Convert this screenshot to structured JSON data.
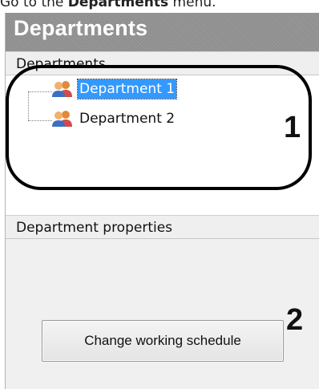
{
  "caption": {
    "prefix": "Go to the ",
    "bold": "Departments",
    "suffix": " menu."
  },
  "window": {
    "title": "Departments",
    "departments_header": "Departments",
    "properties_header": "Department properties"
  },
  "tree": {
    "items": [
      {
        "label": "Department 1",
        "selected": true,
        "icon": "group-users-icon"
      },
      {
        "label": "Department 2",
        "selected": false,
        "icon": "group-users-icon"
      }
    ]
  },
  "properties": {
    "change_schedule_label": "Change working schedule"
  },
  "callouts": {
    "one": "1",
    "two": "2"
  },
  "colors": {
    "selection": "#3399ff",
    "title_bar": "#8f8f8f",
    "panel": "#f0f0f0"
  }
}
